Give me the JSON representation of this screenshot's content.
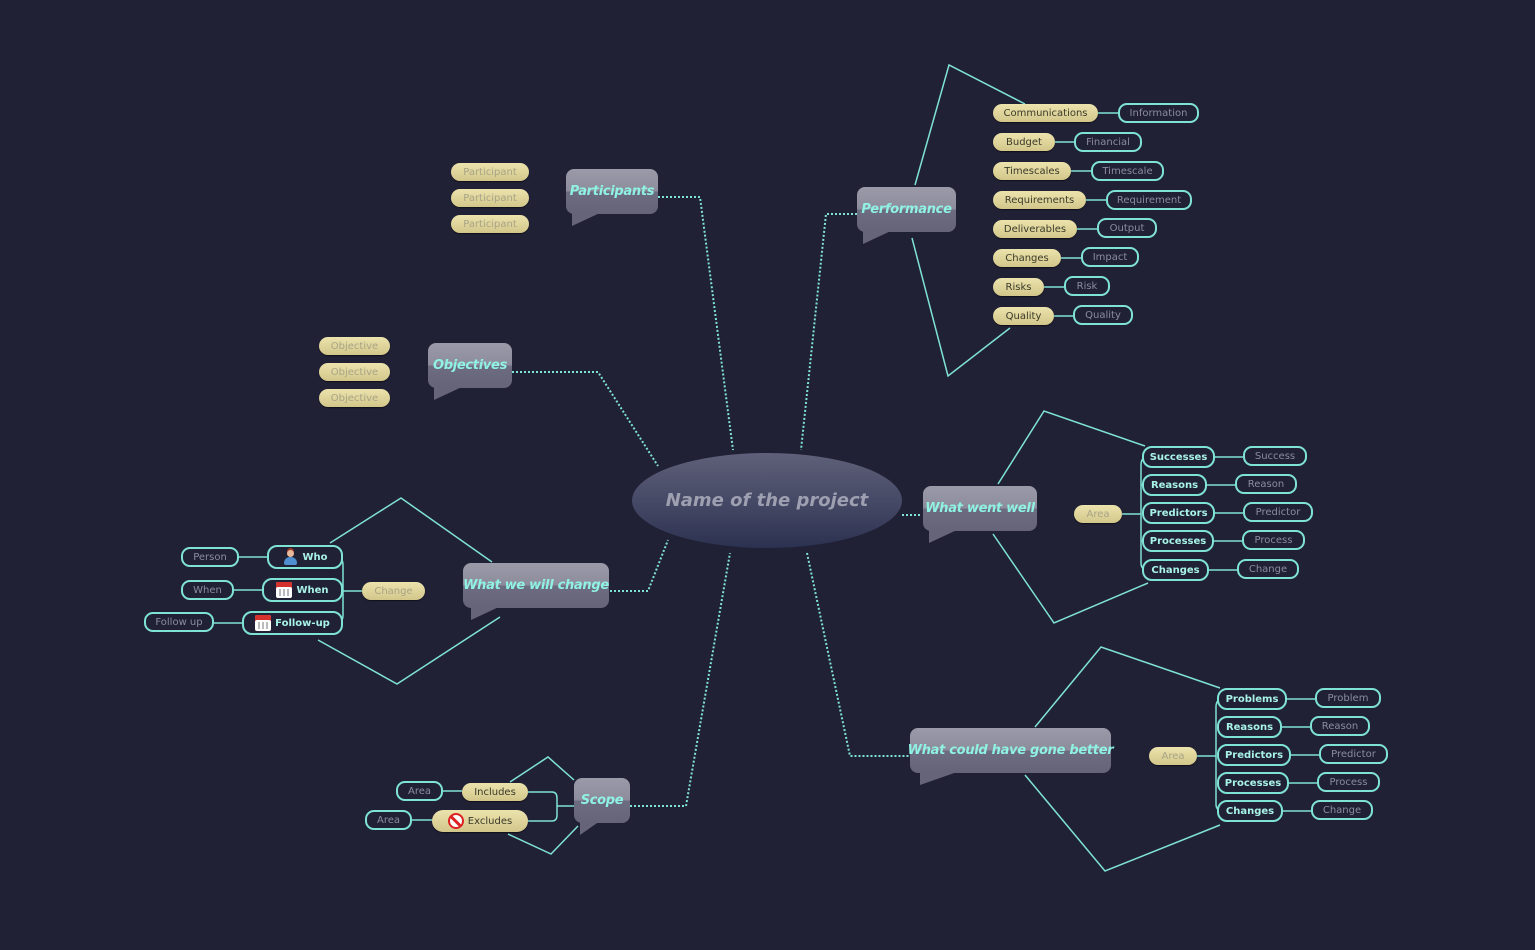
{
  "canvas": {
    "background": "#212136",
    "link_color": "#7fe3d4",
    "tan_node_color": "#e2d79c"
  },
  "central": {
    "label": "Name of the project"
  },
  "branches": {
    "participants": {
      "label": "Participants",
      "items": [
        "Participant",
        "Participant",
        "Participant"
      ]
    },
    "objectives": {
      "label": "Objectives",
      "items": [
        "Objective",
        "Objective",
        "Objective"
      ]
    },
    "performance": {
      "label": "Performance",
      "rows": [
        {
          "topic": "Communications",
          "detail": "Information"
        },
        {
          "topic": "Budget",
          "detail": "Financial"
        },
        {
          "topic": "Timescales",
          "detail": "Timescale"
        },
        {
          "topic": "Requirements",
          "detail": "Requirement"
        },
        {
          "topic": "Deliverables",
          "detail": "Output"
        },
        {
          "topic": "Changes",
          "detail": "Impact"
        },
        {
          "topic": "Risks",
          "detail": "Risk"
        },
        {
          "topic": "Quality",
          "detail": "Quality"
        }
      ]
    },
    "went_well": {
      "label": "What went well",
      "area": "Area",
      "rows": [
        {
          "topic": "Successes",
          "detail": "Success"
        },
        {
          "topic": "Reasons",
          "detail": "Reason"
        },
        {
          "topic": "Predictors",
          "detail": "Predictor"
        },
        {
          "topic": "Processes",
          "detail": "Process"
        },
        {
          "topic": "Changes",
          "detail": "Change"
        }
      ]
    },
    "gone_better": {
      "label": "What could have gone better",
      "area": "Area",
      "rows": [
        {
          "topic": "Problems",
          "detail": "Problem"
        },
        {
          "topic": "Reasons",
          "detail": "Reason"
        },
        {
          "topic": "Predictors",
          "detail": "Predictor"
        },
        {
          "topic": "Processes",
          "detail": "Process"
        },
        {
          "topic": "Changes",
          "detail": "Change"
        }
      ]
    },
    "will_change": {
      "label": "What we will change",
      "change": "Change",
      "rows": [
        {
          "topic": "Who",
          "detail": "Person",
          "icon": "person-icon"
        },
        {
          "topic": "When",
          "detail": "When",
          "icon": "calendar-icon"
        },
        {
          "topic": "Follow-up",
          "detail": "Follow up",
          "icon": "calendar-icon"
        }
      ]
    },
    "scope": {
      "label": "Scope",
      "rows": [
        {
          "topic": "Includes",
          "detail": "Area"
        },
        {
          "topic": "Excludes",
          "detail": "Area",
          "icon": "no-entry-icon"
        }
      ]
    }
  }
}
